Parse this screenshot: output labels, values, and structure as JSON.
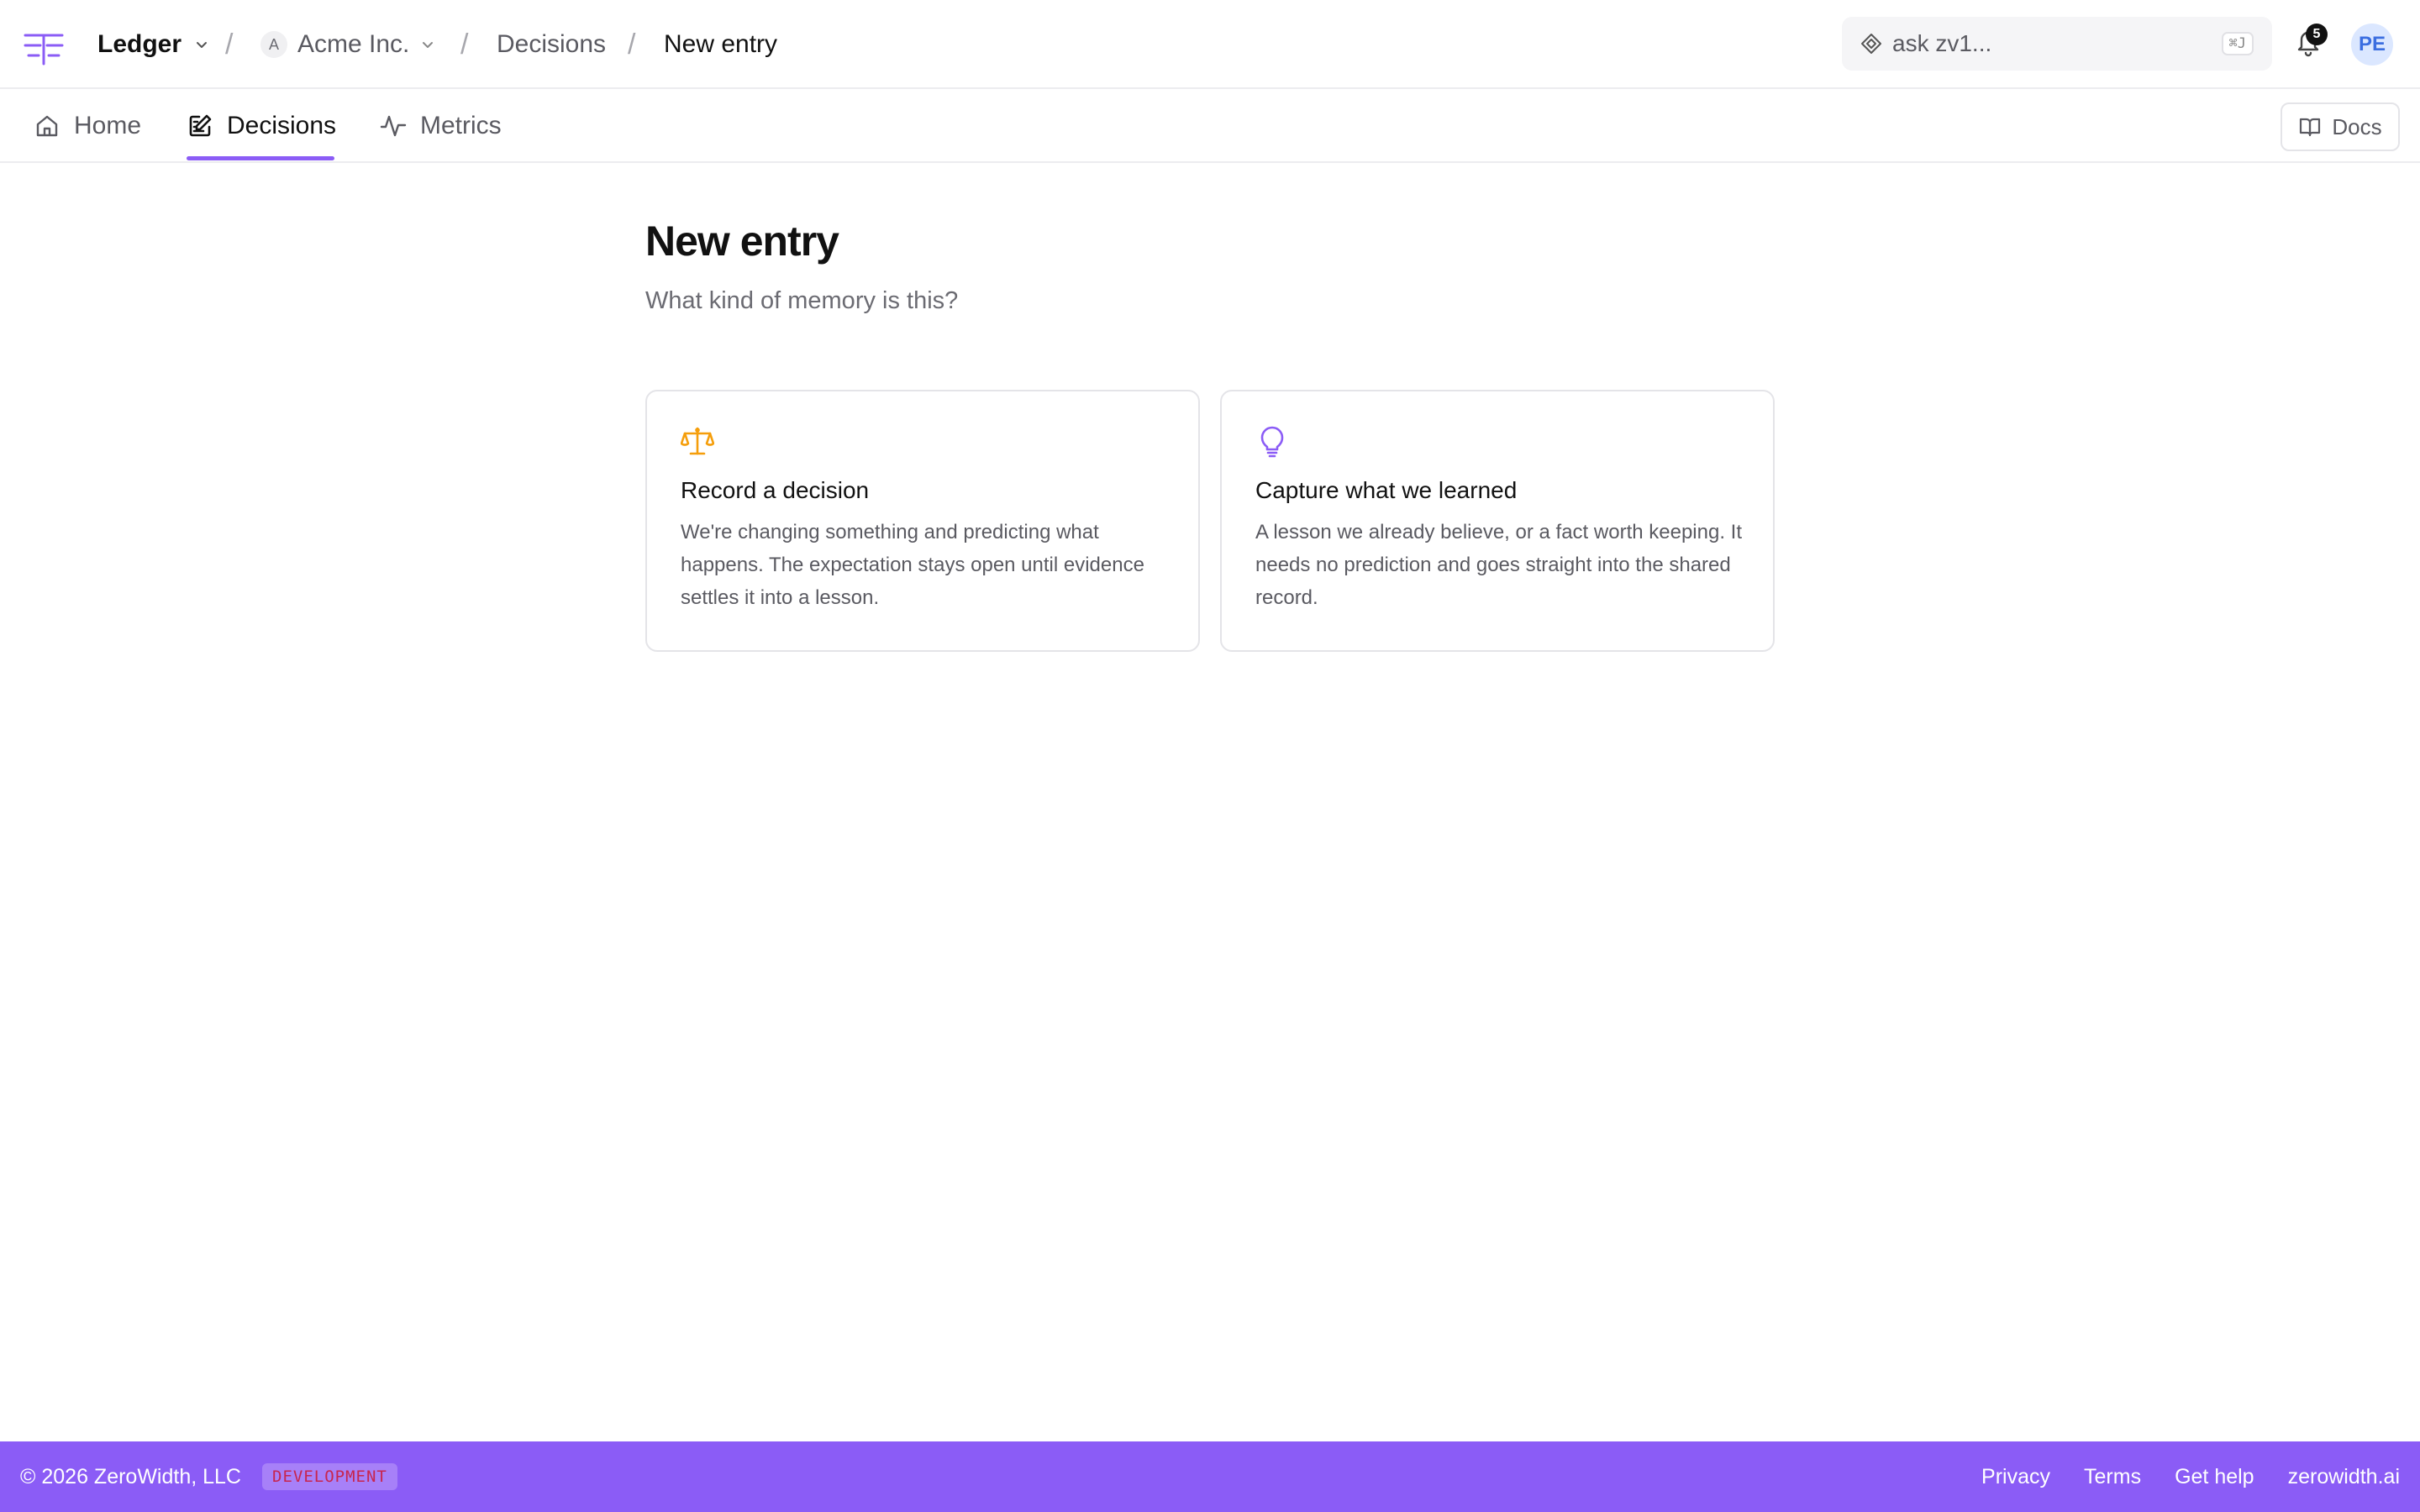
{
  "header": {
    "app_name": "Ledger",
    "org_initial": "A",
    "org_name": "Acme Inc.",
    "breadcrumb_separator": "/",
    "breadcrumb_section": "Decisions",
    "breadcrumb_current": "New entry",
    "search_placeholder": "ask zv1...",
    "search_shortcut": "⌘J",
    "notification_count": "5",
    "avatar_initials": "PE"
  },
  "nav": {
    "tabs": [
      {
        "label": "Home",
        "icon": "home-icon",
        "active": false
      },
      {
        "label": "Decisions",
        "icon": "edit-icon",
        "active": true
      },
      {
        "label": "Metrics",
        "icon": "activity-icon",
        "active": false
      }
    ],
    "docs_label": "Docs"
  },
  "main": {
    "title": "New entry",
    "subtitle": "What kind of memory is this?",
    "cards": [
      {
        "icon": "scale-icon",
        "icon_color": "#f59e0b",
        "title": "Record a decision",
        "description": "We're changing something and predicting what happens. The expectation stays open until evidence settles it into a lesson."
      },
      {
        "icon": "lightbulb-icon",
        "icon_color": "#8b5cf6",
        "title": "Capture what we learned",
        "description": "A lesson we already believe, or a fact worth keeping. It needs no prediction and goes straight into the shared record."
      }
    ]
  },
  "footer": {
    "copyright": "© 2026 ZeroWidth, LLC",
    "environment": "DEVELOPMENT",
    "links": [
      "Privacy",
      "Terms",
      "Get help",
      "zerowidth.ai"
    ]
  },
  "colors": {
    "accent": "#8b5cf6",
    "warning_icon": "#f59e0b",
    "avatar_bg": "#dbe7ff"
  }
}
